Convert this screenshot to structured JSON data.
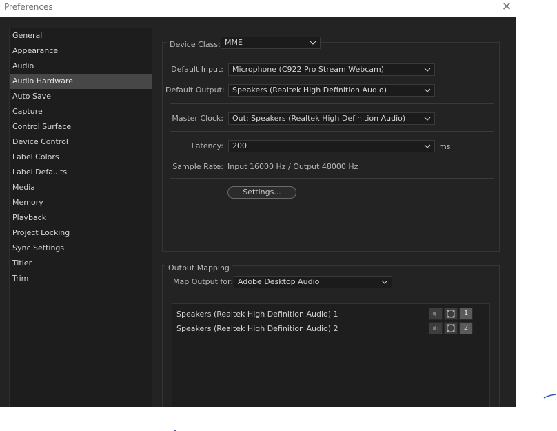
{
  "window": {
    "title": "Preferences"
  },
  "sidebar": {
    "items": [
      {
        "label": "General"
      },
      {
        "label": "Appearance"
      },
      {
        "label": "Audio"
      },
      {
        "label": "Audio Hardware",
        "selected": true
      },
      {
        "label": "Auto Save"
      },
      {
        "label": "Capture"
      },
      {
        "label": "Control Surface"
      },
      {
        "label": "Device Control"
      },
      {
        "label": "Label Colors"
      },
      {
        "label": "Label Defaults"
      },
      {
        "label": "Media"
      },
      {
        "label": "Memory"
      },
      {
        "label": "Playback"
      },
      {
        "label": "Project Locking"
      },
      {
        "label": "Sync Settings"
      },
      {
        "label": "Titler"
      },
      {
        "label": "Trim"
      }
    ]
  },
  "audio_hardware": {
    "device_class_label": "Device Class:",
    "device_class_value": "MME",
    "default_input_label": "Default Input:",
    "default_input_value": "Microphone (C922 Pro Stream Webcam)",
    "default_output_label": "Default Output:",
    "default_output_value": "Speakers (Realtek High Definition Audio)",
    "master_clock_label": "Master Clock:",
    "master_clock_value": "Out: Speakers (Realtek High Definition Audio)",
    "latency_label": "Latency:",
    "latency_value": "200",
    "latency_unit": "ms",
    "sample_rate_label": "Sample Rate:",
    "sample_rate_value": "Input 16000 Hz / Output 48000 Hz",
    "settings_button": "Settings..."
  },
  "output_mapping": {
    "title": "Output Mapping",
    "map_for_label": "Map Output for:",
    "map_for_value": "Adobe Desktop Audio",
    "rows": [
      {
        "name": "Speakers (Realtek High Definition Audio) 1",
        "channel": "1"
      },
      {
        "name": "Speakers (Realtek High Definition Audio) 2",
        "channel": "2"
      }
    ]
  },
  "colors": {
    "panel_bg": "#232323",
    "sidebar_bg": "#1d1d1d",
    "selected_bg": "#474747",
    "text": "#d6d6d6"
  }
}
